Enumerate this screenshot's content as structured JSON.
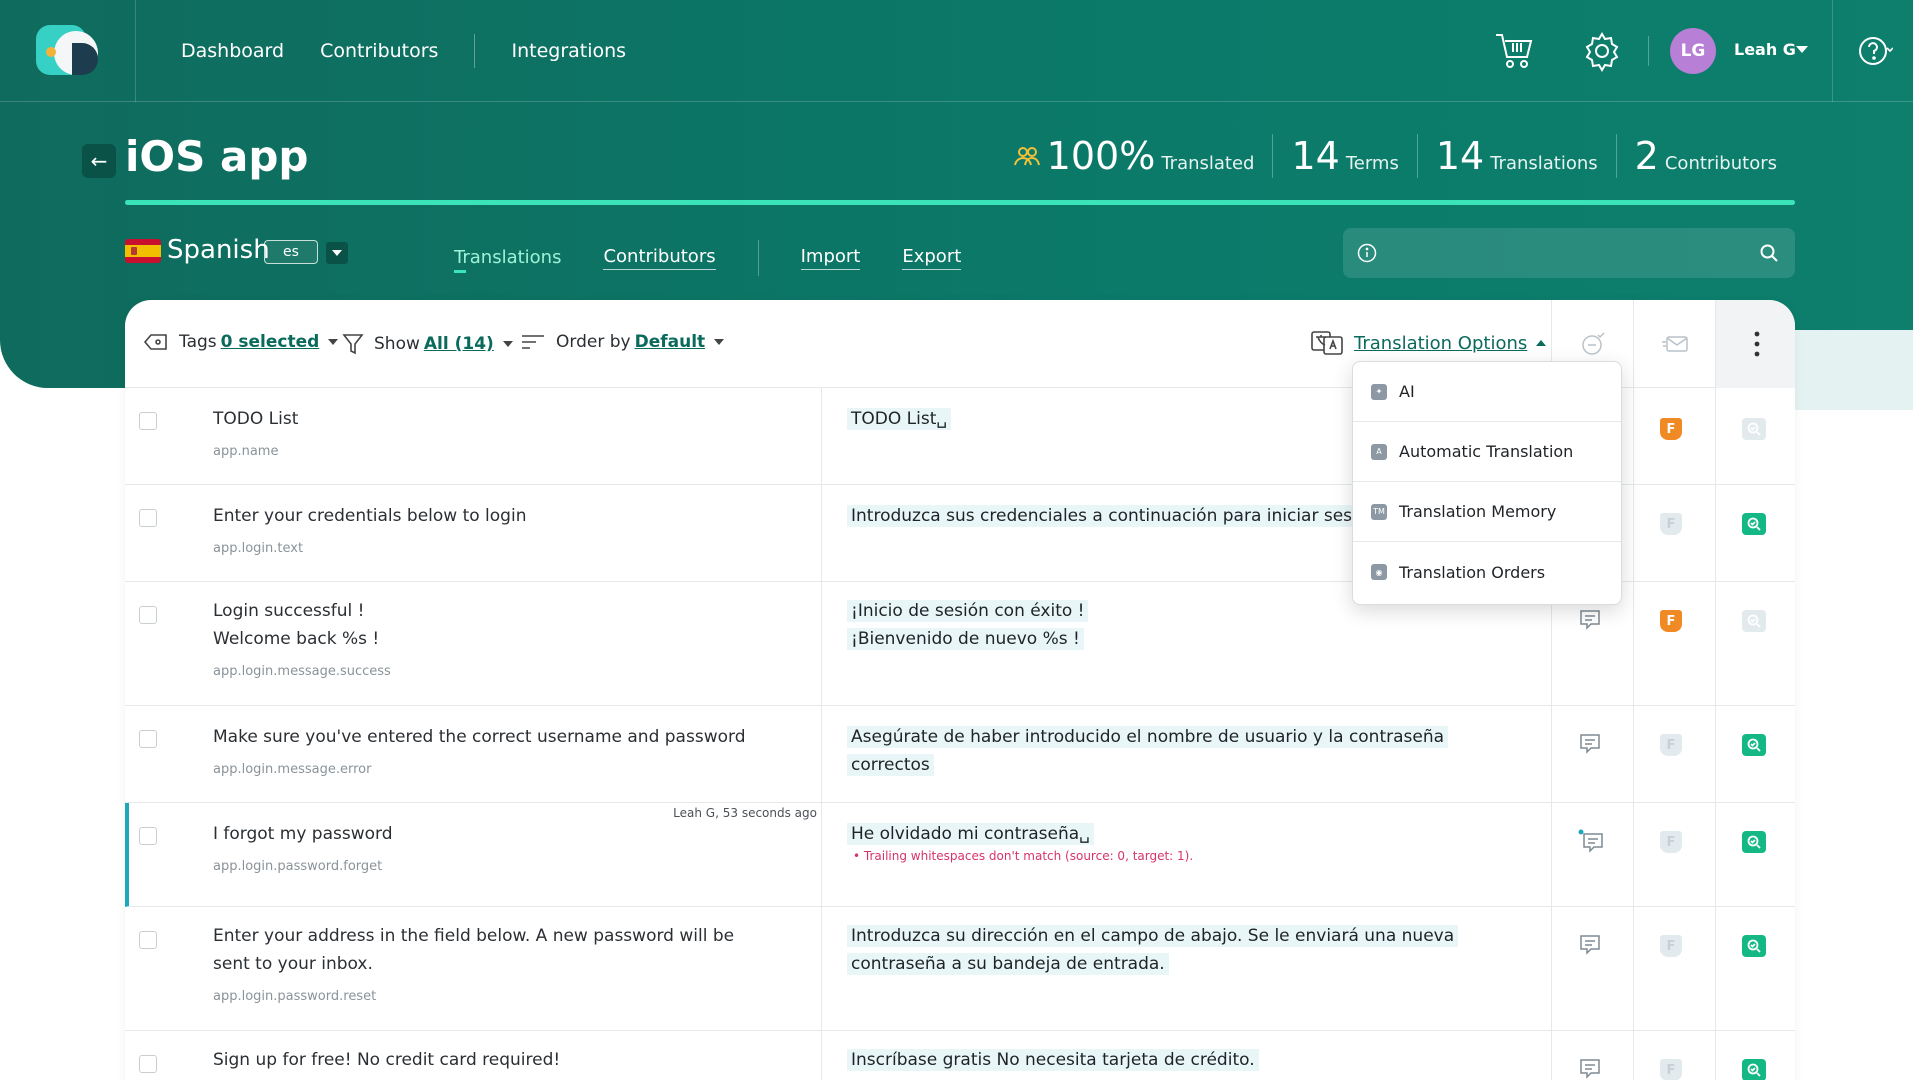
{
  "nav": {
    "links": [
      "Dashboard",
      "Contributors",
      "Integrations"
    ],
    "user": {
      "initials": "LG",
      "name": "Leah G"
    }
  },
  "project": {
    "title": "iOS app",
    "stats": {
      "translated_pct": "100%",
      "translated_label": "Translated",
      "terms": "14",
      "terms_label": "Terms",
      "translations": "14",
      "translations_label": "Translations",
      "contributors": "2",
      "contributors_label": "Contributors"
    },
    "progress": 1.0
  },
  "language": {
    "name": "Spanish",
    "code": "es"
  },
  "subtabs": [
    "Translations",
    "Contributors",
    "Import",
    "Export"
  ],
  "search": {
    "placeholder": ""
  },
  "toolbar": {
    "tags_label": "Tags",
    "tags_value": "0 selected",
    "show_label": "Show",
    "show_value": "All (14)",
    "order_label": "Order by",
    "order_value": "Default",
    "translation_options": "Translation Options"
  },
  "dropdown": {
    "items": [
      {
        "label": "AI",
        "icon": "ai-icon"
      },
      {
        "label": "Automatic Translation",
        "icon": "robot-icon"
      },
      {
        "label": "Translation Memory",
        "icon": "tm-icon"
      },
      {
        "label": "Translation Orders",
        "icon": "order-icon"
      }
    ]
  },
  "rows": [
    {
      "source": "TODO List",
      "key": "app.name",
      "target": "TODO List␣",
      "meta": "",
      "warning": "",
      "f": "on",
      "r": "off"
    },
    {
      "source": "Enter your credentials below to login",
      "key": "app.login.text",
      "target": "Introduzca sus credenciales a continuación para iniciar sesión",
      "meta": "",
      "warning": "",
      "f": "off",
      "r": "on"
    },
    {
      "source": "Login successful !\nWelcome back %s !",
      "key": "app.login.message.success",
      "target": "¡Inicio de sesión con éxito !\n¡Bienvenido de nuevo %s !",
      "meta": "",
      "warning": "",
      "f": "on",
      "r": "off"
    },
    {
      "source": "Make sure you've entered the correct username and password",
      "key": "app.login.message.error",
      "target": "Asegúrate de haber introducido el nombre de usuario y la contraseña correctos",
      "meta": "",
      "warning": "",
      "f": "off",
      "r": "on"
    },
    {
      "source": "I forgot my password",
      "key": "app.login.password.forget",
      "target": "He olvidado mi contraseña␣",
      "meta": "Leah G, 53 seconds ago",
      "warning": "• Trailing whitespaces don't match (source: 0, target: 1).",
      "f": "off",
      "r": "on"
    },
    {
      "source": "Enter your address in the field below. A new password will be sent to your inbox.",
      "key": "app.login.password.reset",
      "target": "Introduzca su dirección en el campo de abajo. Se le enviará una nueva contraseña a su bandeja de entrada.",
      "meta": "",
      "warning": "",
      "f": "off",
      "r": "on"
    },
    {
      "source": "Sign up for free! No credit card required!",
      "key": "",
      "target": "Inscríbase gratis No necesita tarjeta de crédito.",
      "meta": "",
      "warning": "",
      "f": "off",
      "r": "on"
    }
  ],
  "colors": {
    "brand": "#0b7a69",
    "accent": "#3be3b8",
    "link": "#0a6a5c",
    "warning": "#d6336c",
    "flag_on": "#f08a24",
    "review_on": "#14b884"
  }
}
